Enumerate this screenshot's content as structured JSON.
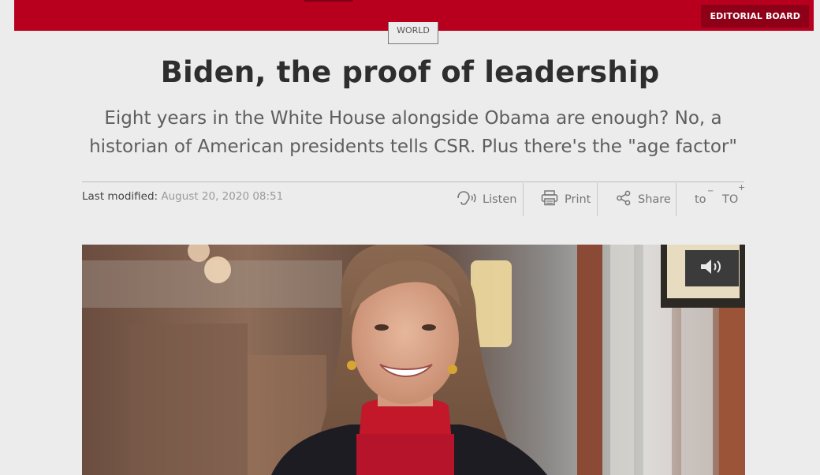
{
  "header": {
    "editorial_label": "EDITORIAL BOARD",
    "accent_color": "#b8001e"
  },
  "article": {
    "section": "WORLD",
    "title": "Biden, the proof of leadership",
    "subtitle": "Eight years in the White House alongside Obama are enough? No, a historian of American presidents tells CSR. Plus there's the \"age factor\"",
    "modified_label": "Last modified:",
    "modified_date": "August 20, 2020 08:51"
  },
  "tools": {
    "listen": "Listen",
    "print": "Print",
    "share": "Share",
    "font_smaller": "to",
    "font_smaller_mark": "−",
    "font_larger": "TO",
    "font_larger_mark": "+"
  },
  "media": {
    "audio_icon": "speaker-icon",
    "image_subject": "portrait-photo"
  }
}
